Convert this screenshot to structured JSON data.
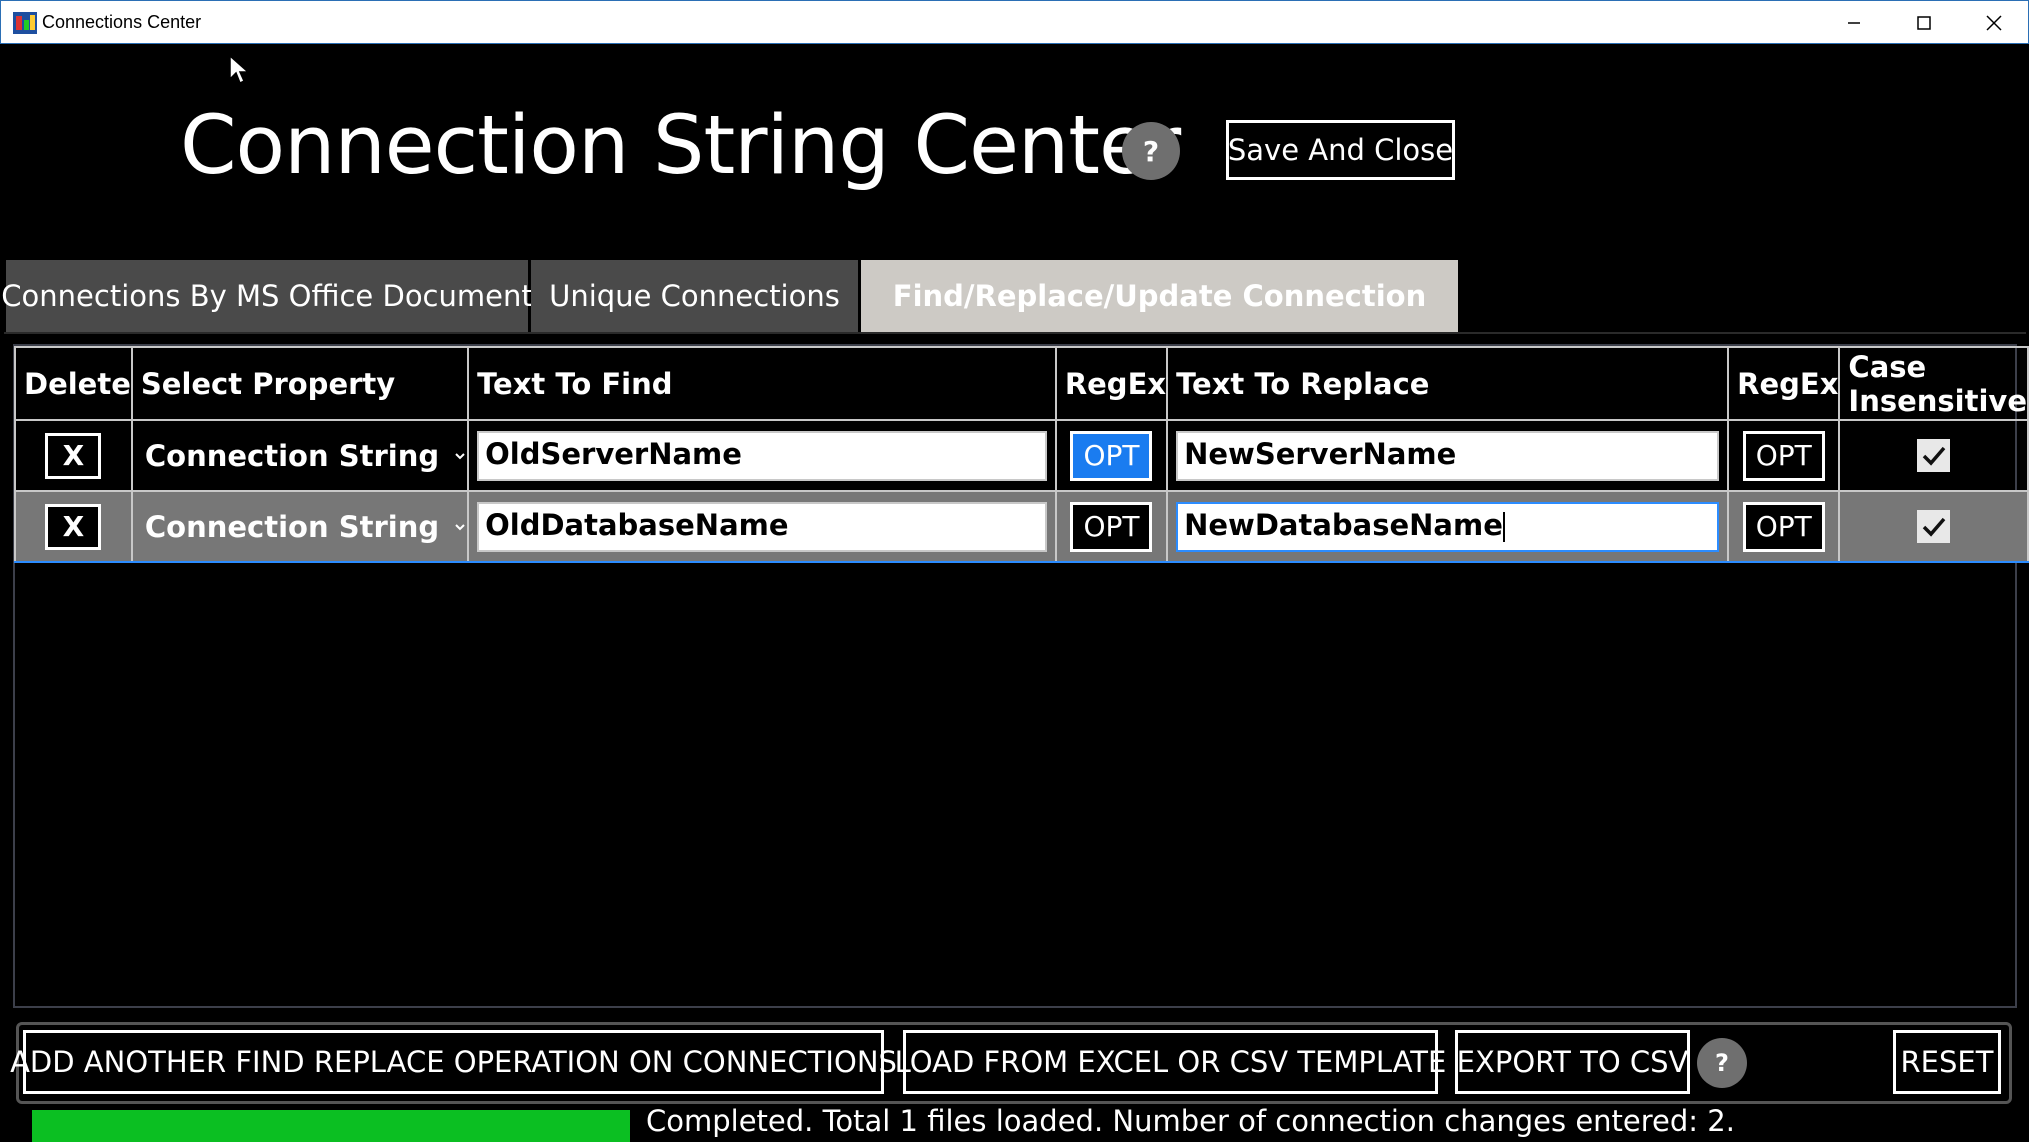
{
  "window": {
    "title": "Connections Center",
    "controls": [
      "minimize-icon",
      "maximize-icon",
      "close-icon"
    ]
  },
  "header": {
    "title": "Connection String Center",
    "help_label": "?",
    "save_close_label": "Save And Close"
  },
  "tabs": [
    {
      "label": "Connections By MS Office Document",
      "active": false
    },
    {
      "label": "Unique Connections",
      "active": false
    },
    {
      "label": "Find/Replace/Update Connection",
      "active": true
    }
  ],
  "grid": {
    "columns": {
      "delete": "Delete",
      "property": "Select Property",
      "find": "Text To Find",
      "regex_find": "RegEx",
      "replace": "Text To Replace",
      "regex_replace": "RegEx",
      "case": "Case Insensitive"
    },
    "rows": [
      {
        "delete_label": "X",
        "property": "Connection String",
        "find": "OldServerName",
        "find_opt": "OPT",
        "find_opt_on": true,
        "replace": "NewServerName",
        "replace_opt": "OPT",
        "case_insensitive": true
      },
      {
        "delete_label": "X",
        "property": "Connection String",
        "find": "OldDatabaseName",
        "find_opt": "OPT",
        "find_opt_on": false,
        "replace": "NewDatabaseName",
        "replace_opt": "OPT",
        "case_insensitive": true
      }
    ]
  },
  "footer": {
    "add_label": "ADD ANOTHER FIND REPLACE OPERATION ON CONNECTIONS",
    "load_label": "LOAD FROM EXCEL OR CSV TEMPLATE",
    "export_label": "EXPORT TO CSV",
    "help_label": "?",
    "reset_label": "RESET",
    "progress": 1.0,
    "status": "Completed. Total 1 files loaded. Number of connection changes entered: 2."
  },
  "colors": {
    "accent_blue": "#1a7cf0",
    "progress_green": "#0bbf22",
    "selected_row": "#777777",
    "active_tab": "#cdcac5"
  }
}
